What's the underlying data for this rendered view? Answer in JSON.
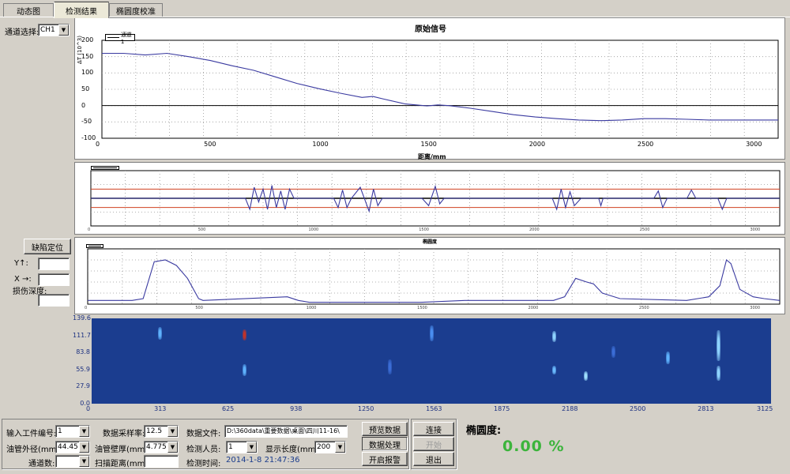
{
  "tabs": [
    {
      "label": "动态图",
      "active": false
    },
    {
      "label": "检测结果",
      "active": true
    },
    {
      "label": "椭圆度校准",
      "active": false
    }
  ],
  "left_panel": {
    "channel_label": "通道选择:",
    "channel_value": "CH1",
    "defect_button": "缺陷定位",
    "y_label": "Y↑:",
    "x_label": "X →:",
    "depth_label": "损伤深度:",
    "y_value": "",
    "x_value": "",
    "depth_value": ""
  },
  "chart1": {
    "title": "原始信号",
    "legend": "通道1",
    "ylabel": "ΔT (10^3)",
    "xlabel": "距离/mm",
    "y_ticks": [
      "200",
      "150",
      "100",
      "50",
      "0",
      "-50",
      "-100"
    ],
    "x_ticks": [
      "0",
      "500",
      "1000",
      "1500",
      "2000",
      "2500",
      "3000"
    ]
  },
  "chart3": {
    "title": "椭圆度"
  },
  "heatmap": {
    "y_ticks": [
      "139.6",
      "111.7",
      "83.8",
      "55.9",
      "27.9",
      "0.0"
    ],
    "x_ticks": [
      "0",
      "313",
      "625",
      "938",
      "1250",
      "1563",
      "1875",
      "2188",
      "2500",
      "2813",
      "3125"
    ],
    "background_color": "#1b3d8f"
  },
  "chart_data": [
    {
      "type": "line",
      "title": "原始信号",
      "xlabel": "距离/mm",
      "ylabel": "ΔT (10^3)",
      "xlim": [
        0,
        3120
      ],
      "ylim": [
        -100,
        200
      ],
      "series": [
        {
          "name": "通道1",
          "x": [
            0,
            100,
            200,
            300,
            400,
            500,
            600,
            700,
            800,
            900,
            1000,
            1100,
            1200,
            1250,
            1300,
            1400,
            1500,
            1550,
            1600,
            1700,
            1800,
            1900,
            2000,
            2100,
            2200,
            2300,
            2400,
            2500,
            2600,
            2700,
            2800,
            2900,
            3000,
            3120
          ],
          "y": [
            160,
            160,
            155,
            160,
            150,
            138,
            122,
            108,
            88,
            68,
            52,
            38,
            25,
            28,
            20,
            5,
            -1,
            2,
            0,
            -8,
            -18,
            -28,
            -35,
            -40,
            -44,
            -46,
            -44,
            -40,
            -40,
            -42,
            -44,
            -44,
            -44,
            -44
          ]
        }
      ]
    },
    {
      "type": "line",
      "xlim": [
        0,
        3120
      ],
      "ylim": [
        -1.5,
        1.5
      ],
      "thresholds": [
        0.5,
        -0.5
      ],
      "series": [
        {
          "x": [
            0,
            700,
            720,
            740,
            760,
            780,
            800,
            820,
            840,
            860,
            880,
            900,
            920,
            960,
            1000,
            1100,
            1120,
            1140,
            1160,
            1180,
            1220,
            1260,
            1280,
            1300,
            1320,
            1340,
            1500,
            1530,
            1560,
            1580,
            1600,
            2090,
            2110,
            2130,
            2150,
            2170,
            2190,
            2220,
            2300,
            2310,
            2320,
            2550,
            2570,
            2590,
            2610,
            2700,
            2720,
            2740,
            2840,
            2860,
            2880,
            3120
          ],
          "y": [
            0,
            0,
            -0.6,
            0.6,
            -0.2,
            0.5,
            -0.6,
            0.7,
            -0.5,
            0.4,
            -0.6,
            0.5,
            0,
            0,
            0,
            0,
            -0.5,
            0.45,
            -0.5,
            0,
            0.6,
            -0.7,
            0.5,
            -0.4,
            0,
            0,
            0,
            -0.4,
            0.65,
            -0.3,
            0,
            0,
            -0.6,
            0.5,
            -0.5,
            0.35,
            -0.4,
            0,
            0,
            -0.4,
            0,
            0,
            0.4,
            -0.5,
            0,
            0,
            0.45,
            0,
            0,
            -0.6,
            0,
            0
          ]
        }
      ]
    },
    {
      "type": "line",
      "title": "椭圆度",
      "xlim": [
        0,
        3120
      ],
      "ylim": [
        0,
        30
      ],
      "series": [
        {
          "x": [
            0,
            200,
            250,
            300,
            350,
            400,
            450,
            500,
            520,
            900,
            950,
            1000,
            1500,
            1700,
            2000,
            2100,
            2150,
            2200,
            2250,
            2280,
            2320,
            2400,
            2700,
            2800,
            2850,
            2880,
            2900,
            2940,
            3000,
            3050,
            3120
          ],
          "y": [
            2,
            2,
            3,
            23,
            24,
            21,
            14,
            3,
            2,
            4,
            2,
            1,
            1,
            2,
            2,
            2,
            4,
            14,
            12,
            11,
            6,
            3,
            2,
            4,
            10,
            24,
            22,
            8,
            4,
            3,
            2
          ]
        }
      ]
    },
    {
      "type": "heatmap",
      "xlim": [
        0,
        3125
      ],
      "ylim": [
        0,
        139.6
      ],
      "hotspots": [
        {
          "x": 313,
          "y": 115,
          "h": 20,
          "c": "#5fb3ff"
        },
        {
          "x": 700,
          "y": 112,
          "h": 18,
          "c": "#c0332a"
        },
        {
          "x": 700,
          "y": 55,
          "h": 20,
          "c": "#5fb3ff"
        },
        {
          "x": 1563,
          "y": 115,
          "h": 25,
          "c": "#4a8ef0"
        },
        {
          "x": 2125,
          "y": 110,
          "h": 18,
          "c": "#8fd4ff"
        },
        {
          "x": 2125,
          "y": 55,
          "h": 15,
          "c": "#6bbcff"
        },
        {
          "x": 2270,
          "y": 45,
          "h": 15,
          "c": "#9fe0ff"
        },
        {
          "x": 2650,
          "y": 75,
          "h": 20,
          "c": "#5fb3ff"
        },
        {
          "x": 2880,
          "y": 95,
          "h": 50,
          "c": "#8fd4ff"
        },
        {
          "x": 2880,
          "y": 50,
          "h": 25,
          "c": "#8fd4ff"
        },
        {
          "x": 1370,
          "y": 60,
          "h": 25,
          "c": "#3b6dd6"
        },
        {
          "x": 2400,
          "y": 85,
          "h": 20,
          "c": "#3b6dd6"
        }
      ]
    }
  ],
  "bottom": {
    "workpiece_label": "输入工件编号:",
    "workpiece_value": "1",
    "od_label": "油管外径(mm):",
    "od_value": "44.45",
    "channels_label": "通道数:",
    "channels_value": "",
    "sample_rate_label": "数据采样率:",
    "sample_rate_value": "12.5",
    "wall_label": "油管壁厚(mm):",
    "wall_value": "4.775",
    "scan_label": "扫描距离(mm):",
    "scan_value": "",
    "datafile_label": "数据文件:",
    "datafile_value": "D:\\360data\\重要数据\\桌面\\四川11-16\\",
    "inspector_label": "检测人员:",
    "inspector_value": "1",
    "display_len_label": "显示长度(mm):",
    "display_len_value": "200",
    "time_label": "检测时间:",
    "time_value": "2014-1-8 21:47:36",
    "btn_preview": "预览数据",
    "btn_process": "数据处理",
    "btn_alarm": "开启报警",
    "btn_connect": "连接",
    "btn_start": "开始",
    "btn_exit": "退出",
    "ovality_title": "椭圆度:",
    "ovality_value": "0.00 %"
  },
  "colors": {
    "threshold": "#d04020",
    "trace": "#3a3aa0",
    "ovality_green": "#3cb43c"
  }
}
